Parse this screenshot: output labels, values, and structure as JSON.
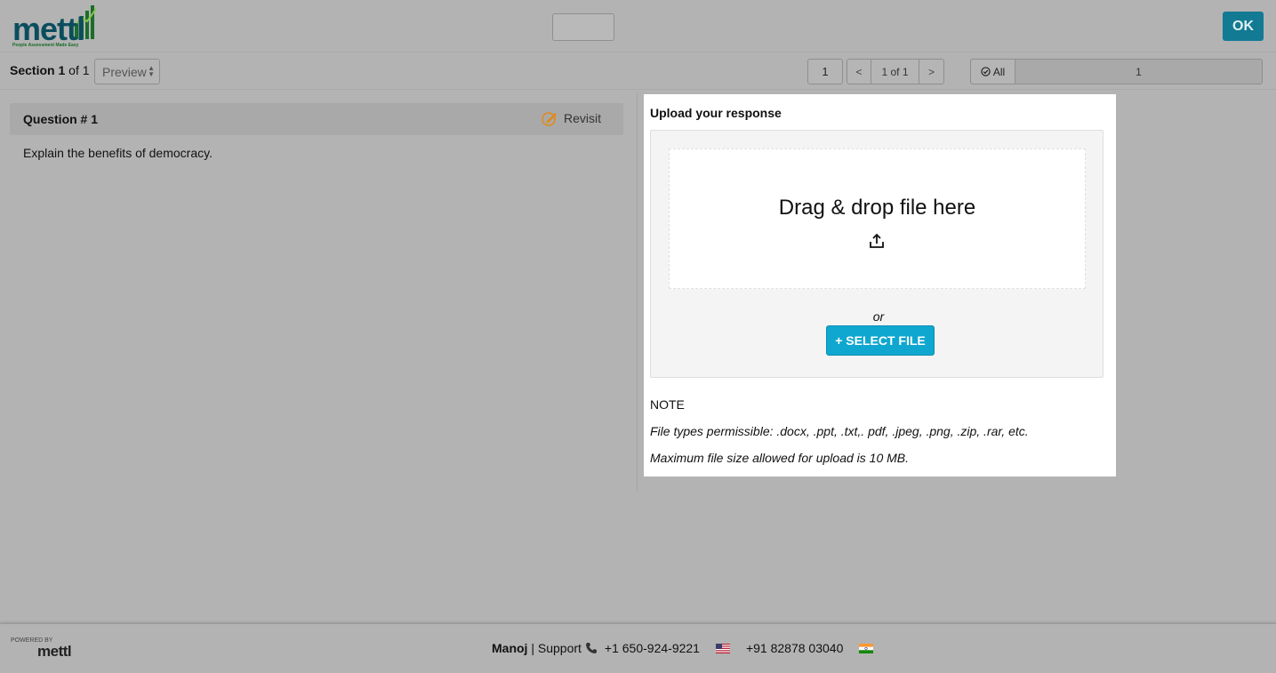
{
  "header": {
    "logo_text": "mettl",
    "logo_tagline": "People Assessment Made Easy",
    "ok_label": "OK"
  },
  "section_bar": {
    "section_word": "Section",
    "section_number": "1",
    "section_of": "of 1",
    "view_select": "Preview",
    "page_input": "1",
    "prev_label": "<",
    "page_count": "1 of 1",
    "next_label": ">",
    "filter_all_label": "All",
    "filter_count": "1"
  },
  "question": {
    "title": "Question # 1",
    "revisit_label": "Revisit",
    "text": "Explain the benefits of democracy."
  },
  "upload": {
    "title": "Upload your response",
    "drop_text": "Drag & drop file here",
    "or_text": "or",
    "select_button": "+ SELECT FILE",
    "note_title": "NOTE",
    "note_file_types": "File types permissible: .docx, .ppt, .txt,. pdf, .jpeg, .png, .zip, .rar, etc.",
    "note_max_size": "Maximum file size allowed for upload is 10 MB."
  },
  "footer": {
    "powered_by": "POWERED BY",
    "powered_logo": "mettl",
    "user_name": "Manoj",
    "separator": " | ",
    "support_label": "Support",
    "phone_us": "+1 650-924-9221",
    "phone_in": "+91 82878 03040"
  },
  "colors": {
    "accent": "#0fa7cf",
    "ok_button": "#127a93",
    "overlay_bg": "#b3b3b3",
    "revisit_icon": "#e08a1e"
  }
}
